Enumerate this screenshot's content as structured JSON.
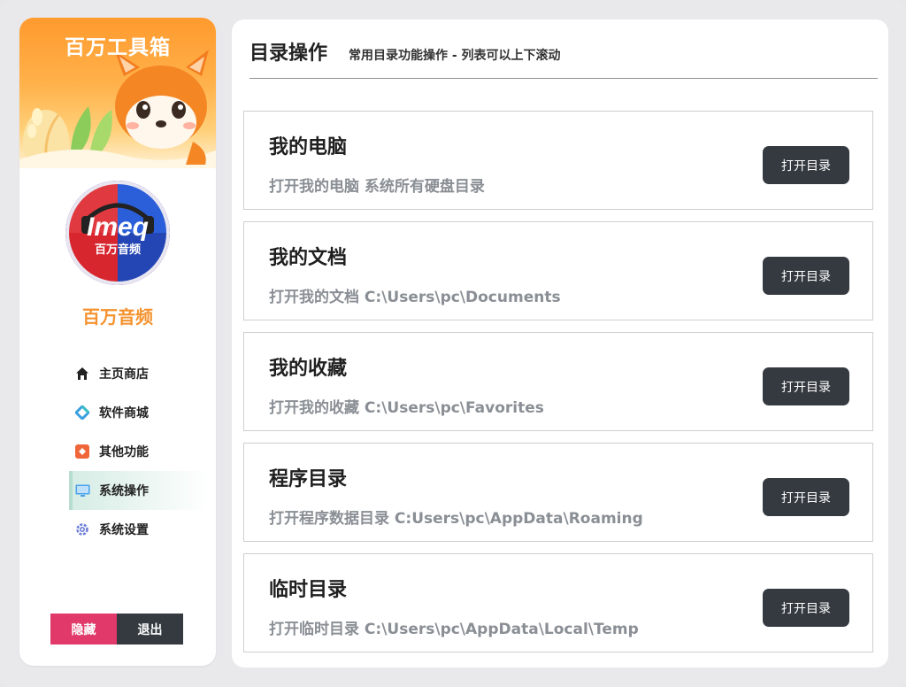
{
  "app": {
    "banner_title": "百万工具箱",
    "brand_name": "百万音频",
    "avatar_text_main": "Imeq",
    "avatar_text_sub": "百万音频"
  },
  "sidebar": {
    "items": [
      {
        "label": "主页商店",
        "icon": "home-icon"
      },
      {
        "label": "软件商城",
        "icon": "diamond-icon"
      },
      {
        "label": "其他功能",
        "icon": "apps-icon"
      },
      {
        "label": "系统操作",
        "icon": "monitor-icon",
        "active": true
      },
      {
        "label": "系统设置",
        "icon": "gear-icon"
      }
    ],
    "hide_label": "隐藏",
    "exit_label": "退出"
  },
  "main": {
    "title": "目录操作",
    "subtitle": "常用目录功能操作 - 列表可以上下滚动",
    "cards": [
      {
        "title": "我的电脑",
        "desc": "打开我的电脑 系统所有硬盘目录",
        "button": "打开目录"
      },
      {
        "title": "我的文档",
        "desc": "打开我的文档 C:\\Users\\pc\\Documents",
        "button": "打开目录"
      },
      {
        "title": "我的收藏",
        "desc": "打开我的收藏 C:\\Users\\pc\\Favorites",
        "button": "打开目录"
      },
      {
        "title": "程序目录",
        "desc": "打开程序数据目录 C:Users\\pc\\AppData\\Roaming",
        "button": "打开目录"
      },
      {
        "title": "临时目录",
        "desc": "打开临时目录 C:\\Users\\pc\\AppData\\Local\\Temp",
        "button": "打开目录"
      }
    ]
  },
  "colors": {
    "accent_orange": "#f5922e",
    "hide_button": "#e0396a",
    "dark_button": "#343a40"
  }
}
